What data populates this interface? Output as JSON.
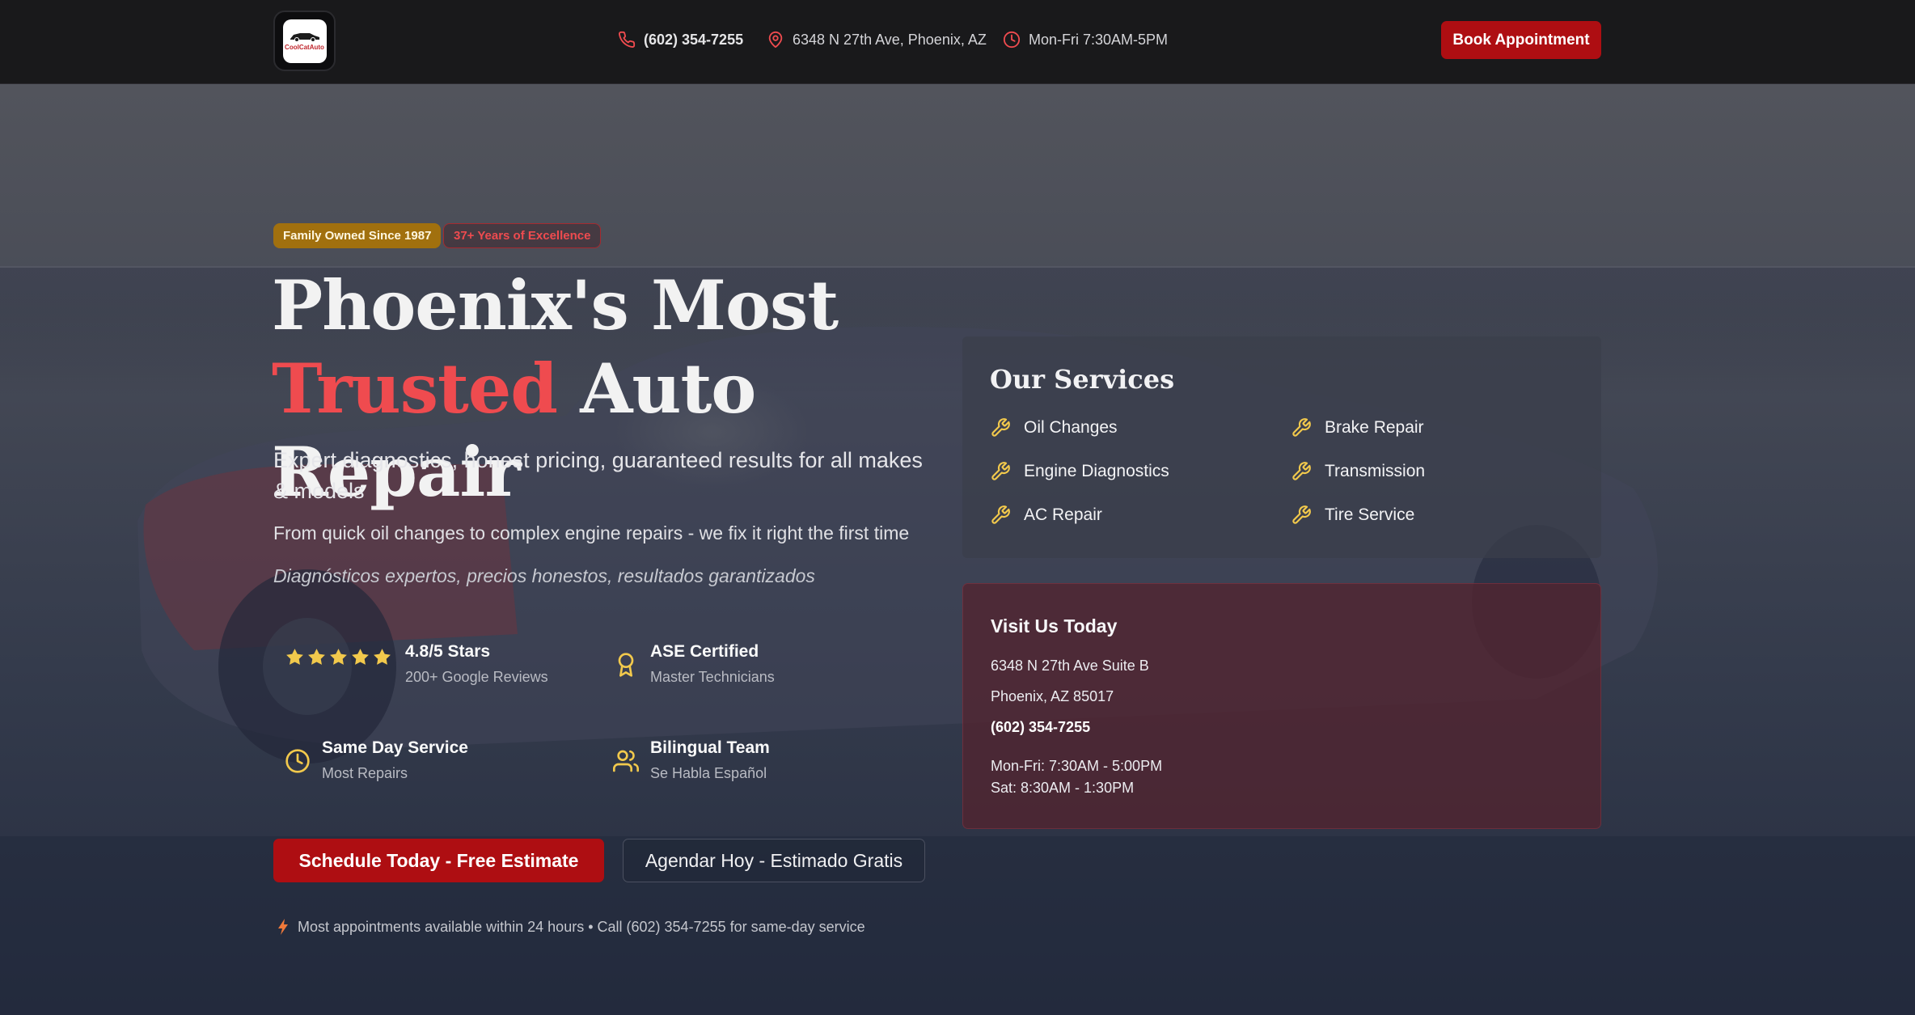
{
  "header": {
    "logo_text": "CoolCatAuto",
    "phone": "(602) 354-7255",
    "address": "6348 N 27th Ave, Phoenix, AZ",
    "hours": "Mon-Fri 7:30AM-5PM",
    "book_label": "Book Appointment"
  },
  "hero": {
    "badges": [
      "Family Owned Since 1987",
      "37+ Years of Excellence"
    ],
    "title_line1": "Phoenix's Most",
    "title_accent": "Trusted",
    "title_rest": "Auto Repair",
    "subtitle": "Expert diagnostics, honest pricing, guaranteed results for all makes & models",
    "tagline": "From quick oil changes to complex engine repairs - we fix it right the first time",
    "spanish": "Diagnósticos expertos, precios honestos, resultados garantizados",
    "features": [
      {
        "title": "4.8/5 Stars",
        "sub": "200+ Google Reviews",
        "icon": "star-icon",
        "rating": 4.8
      },
      {
        "title": "ASE Certified",
        "sub": "Master Technicians",
        "icon": "award-icon"
      },
      {
        "title": "Same Day Service",
        "sub": "Most Repairs",
        "icon": "clock-icon"
      },
      {
        "title": "Bilingual Team",
        "sub": "Se Habla Español",
        "icon": "users-icon"
      }
    ],
    "cta_primary": "Schedule Today - Free Estimate",
    "cta_secondary": "Agendar Hoy - Estimado Gratis",
    "notice": "Most appointments available within 24 hours • Call (602) 354-7255 for same-day service"
  },
  "services": {
    "title": "Our Services",
    "items": [
      "Oil Changes",
      "Brake Repair",
      "Engine Diagnostics",
      "Transmission",
      "AC Repair",
      "Tire Service"
    ]
  },
  "visit": {
    "title": "Visit Us Today",
    "address_line1": "6348 N 27th Ave Suite B",
    "address_line2": "Phoenix, AZ 85017",
    "phone": "(602) 354-7255",
    "hours_weekday": "Mon-Fri: 7:30AM - 5:00PM",
    "hours_saturday": "Sat: 8:30AM - 1:30PM"
  },
  "colors": {
    "brand_red": "#ae0e12",
    "accent_red": "#ef4b4f",
    "gold": "#f2c94c",
    "header_bg": "#19191b"
  }
}
